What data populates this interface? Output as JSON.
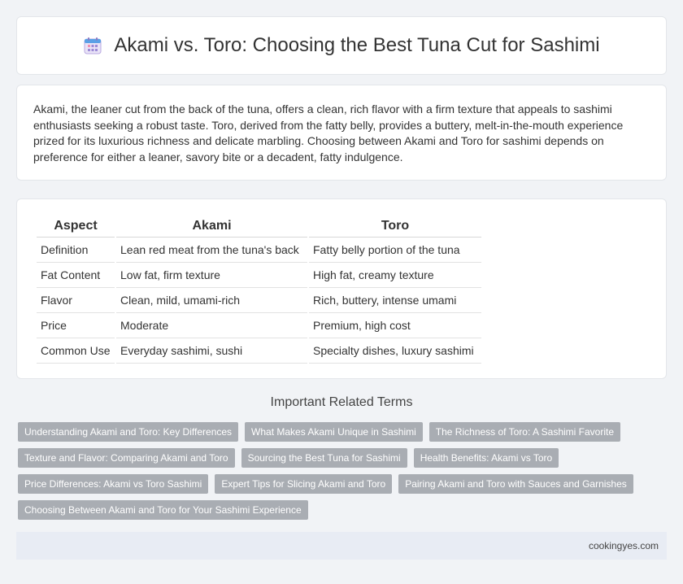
{
  "header": {
    "icon": "calendar-icon",
    "title": "Akami vs. Toro: Choosing the Best Tuna Cut for Sashimi"
  },
  "intro": {
    "text": "Akami, the leaner cut from the back of the tuna, offers a clean, rich flavor with a firm texture that appeals to sashimi enthusiasts seeking a robust taste. Toro, derived from the fatty belly, provides a buttery, melt-in-the-mouth experience prized for its luxurious richness and delicate marbling. Choosing between Akami and Toro for sashimi depends on preference for either a leaner, savory bite or a decadent, fatty indulgence."
  },
  "comparison": {
    "headers": [
      "Aspect",
      "Akami",
      "Toro"
    ],
    "rows": [
      [
        "Definition",
        "Lean red meat from the tuna's back",
        "Fatty belly portion of the tuna"
      ],
      [
        "Fat Content",
        "Low fat, firm texture",
        "High fat, creamy texture"
      ],
      [
        "Flavor",
        "Clean, mild, umami-rich",
        "Rich, buttery, intense umami"
      ],
      [
        "Price",
        "Moderate",
        "Premium, high cost"
      ],
      [
        "Common Use",
        "Everyday sashimi, sushi",
        "Specialty dishes, luxury sashimi"
      ]
    ]
  },
  "related": {
    "title": "Important Related Terms",
    "tags": [
      "Understanding Akami and Toro: Key Differences",
      "What Makes Akami Unique in Sashimi",
      "The Richness of Toro: A Sashimi Favorite",
      "Texture and Flavor: Comparing Akami and Toro",
      "Sourcing the Best Tuna for Sashimi",
      "Health Benefits: Akami vs Toro",
      "Price Differences: Akami vs Toro Sashimi",
      "Expert Tips for Slicing Akami and Toro",
      "Pairing Akami and Toro with Sauces and Garnishes",
      "Choosing Between Akami and Toro for Your Sashimi Experience"
    ]
  },
  "footer": {
    "site": "cookingyes.com"
  },
  "colors": {
    "background": "#f1f3f6",
    "tag_bg": "#a9adb3",
    "footer_bg": "#e8ecf4"
  }
}
